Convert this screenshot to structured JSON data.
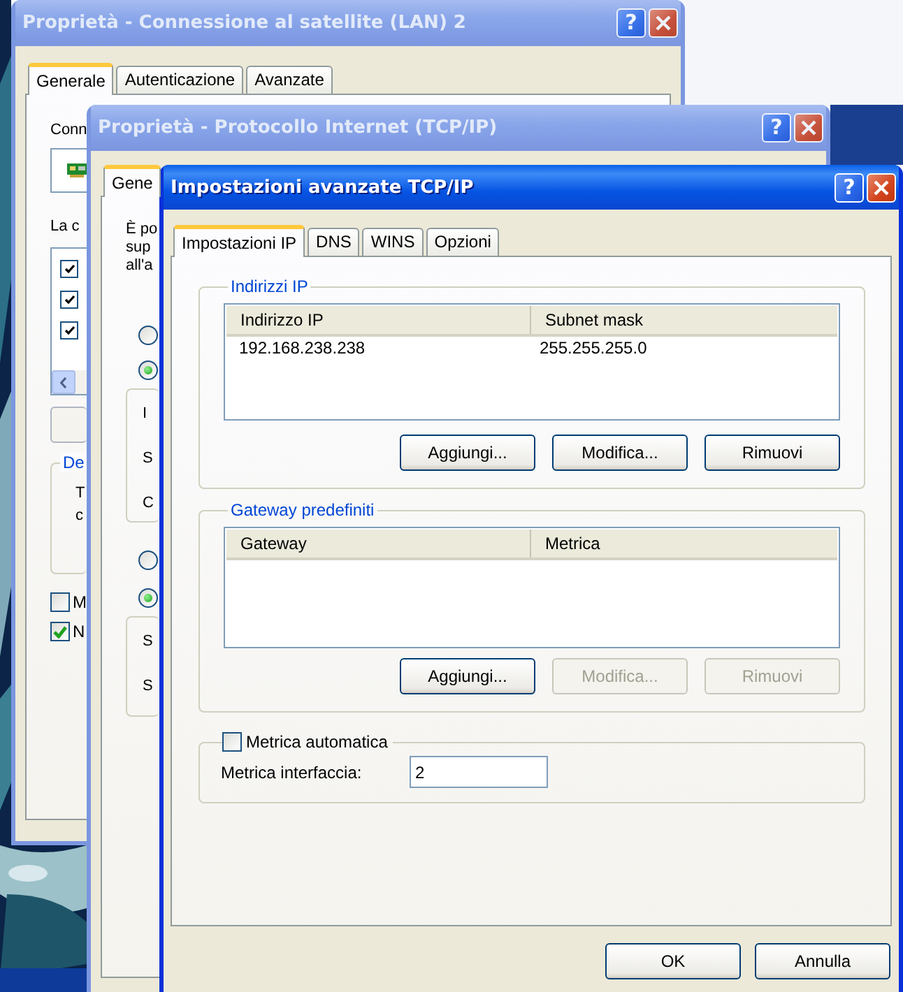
{
  "back_window_1": {
    "title": "Proprietà - Connessione al satellite (LAN) 2",
    "active": false,
    "help_button": "?",
    "tabs": [
      {
        "label": "Generale",
        "selected": true
      },
      {
        "label": "Autenticazione",
        "selected": false
      },
      {
        "label": "Avanzate",
        "selected": false
      }
    ],
    "connect_label": "Conn",
    "list_label": "La c",
    "components": [
      {
        "checked": true
      },
      {
        "checked": true
      },
      {
        "checked": true
      }
    ],
    "description_group": "De",
    "description_lines": [
      "T",
      "c"
    ],
    "options": [
      {
        "label": "M",
        "checked": false
      },
      {
        "label": "N",
        "checked": true
      }
    ]
  },
  "back_window_2": {
    "title": "Proprietà - Protocollo Internet (TCP/IP)",
    "active": false,
    "help_button": "?",
    "tabs": [
      {
        "label": "Gene",
        "selected": true
      }
    ],
    "intro_lines": [
      "È po",
      "sup",
      "all'a"
    ],
    "ip_choice": [
      {
        "selected": false
      },
      {
        "selected": true
      }
    ],
    "ip_fields": [
      "I",
      "S",
      "C"
    ],
    "dns_choice": [
      {
        "selected": false
      },
      {
        "selected": true
      }
    ],
    "dns_fields": [
      "S",
      "S"
    ]
  },
  "window": {
    "title": "Impostazioni avanzate TCP/IP",
    "active": true,
    "help_button": "?",
    "tabs": [
      {
        "label": "Impostazioni IP",
        "selected": true
      },
      {
        "label": "DNS",
        "selected": false
      },
      {
        "label": "WINS",
        "selected": false
      },
      {
        "label": "Opzioni",
        "selected": false
      }
    ],
    "ip_addresses": {
      "title": "Indirizzi IP",
      "columns": [
        "Indirizzo IP",
        "Subnet mask"
      ],
      "rows": [
        [
          "192.168.238.238",
          "255.255.255.0"
        ]
      ],
      "buttons": [
        {
          "label": "Aggiungi...",
          "disabled": false
        },
        {
          "label": "Modifica...",
          "disabled": false
        },
        {
          "label": "Rimuovi",
          "disabled": false
        }
      ]
    },
    "gateways": {
      "title": "Gateway predefiniti",
      "columns": [
        "Gateway",
        "Metrica"
      ],
      "buttons": [
        {
          "label": "Aggiungi...",
          "disabled": false
        },
        {
          "label": "Modifica...",
          "disabled": true
        },
        {
          "label": "Rimuovi",
          "disabled": true
        }
      ]
    },
    "metric": {
      "label": "Metrica automatica",
      "checked": false,
      "interface_label": "Metrica interfaccia:",
      "interface_value": "2"
    },
    "buttons": [
      "OK",
      "Annulla"
    ]
  }
}
